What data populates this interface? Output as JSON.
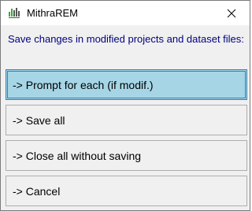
{
  "window": {
    "title": "MithraREM",
    "app_icon": "mithrarem-logo-icon",
    "close_icon": "close-icon"
  },
  "dialog": {
    "message": "Save changes in modified projects and dataset files:",
    "options": [
      {
        "label": "-> Prompt for each (if modif.)",
        "selected": true
      },
      {
        "label": "-> Save all",
        "selected": false
      },
      {
        "label": "-> Close all without saving",
        "selected": false
      },
      {
        "label": "-> Cancel",
        "selected": false
      }
    ]
  },
  "colors": {
    "message_text": "#000080",
    "selected_button": "#a6d6e6",
    "logo_green": "#3aa63a",
    "logo_gray": "#555555"
  }
}
